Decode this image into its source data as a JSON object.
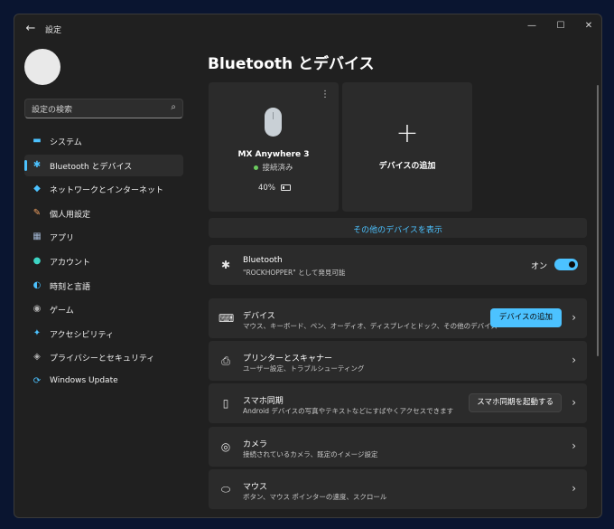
{
  "window": {
    "title": "設定",
    "back_icon": "←",
    "minimize_icon": "—",
    "maximize_icon": "☐",
    "close_icon": "✕"
  },
  "search": {
    "placeholder": "設定の検索",
    "icon": "⌕"
  },
  "sidebar": {
    "items": [
      {
        "label": "システム",
        "icon": "▬",
        "color": "#4cc2ff"
      },
      {
        "label": "Bluetooth とデバイス",
        "icon": "✱",
        "color": "#4cc2ff",
        "active": true
      },
      {
        "label": "ネットワークとインターネット",
        "icon": "◆",
        "color": "#4cc2ff"
      },
      {
        "label": "個人用設定",
        "icon": "✎",
        "color": "#f4a261"
      },
      {
        "label": "アプリ",
        "icon": "▦",
        "color": "#a0b4d0"
      },
      {
        "label": "アカウント",
        "icon": "●",
        "color": "#3dd5c4"
      },
      {
        "label": "時刻と言語",
        "icon": "◐",
        "color": "#4cc2ff"
      },
      {
        "label": "ゲーム",
        "icon": "◉",
        "color": "#b0b0b0"
      },
      {
        "label": "アクセシビリティ",
        "icon": "✦",
        "color": "#4cc2ff"
      },
      {
        "label": "プライバシーとセキュリティ",
        "icon": "◈",
        "color": "#b0b0b0"
      },
      {
        "label": "Windows Update",
        "icon": "⟳",
        "color": "#4cc2ff"
      }
    ]
  },
  "main": {
    "page_title": "Bluetooth とデバイス",
    "device": {
      "name": "MX Anywhere 3",
      "status": "接続済み",
      "battery": "40%",
      "battery_level": 0.4,
      "more_icon": "⋮"
    },
    "add_device": {
      "icon": "+",
      "label": "デバイスの追加"
    },
    "show_more": "その他のデバイスを表示",
    "bluetooth": {
      "icon": "✱",
      "title": "Bluetooth",
      "subtitle": "\"ROCKHOPPER\" として発見可能",
      "toggle_label": "オン",
      "toggle_on": true
    },
    "rows": [
      {
        "icon": "⌨",
        "title": "デバイス",
        "subtitle": "マウス、キーボード、ペン、オーディオ、ディスプレイとドック、その他のデバイス",
        "button": "デバイスの追加",
        "button_style": "accent"
      },
      {
        "icon": "⎙",
        "title": "プリンターとスキャナー",
        "subtitle": "ユーザー設定、トラブルシューティング"
      },
      {
        "icon": "▯",
        "title": "スマホ同期",
        "subtitle": "Android デバイスの写真やテキストなどにすばやくアクセスできます",
        "button": "スマホ同期を起動する",
        "button_style": "plain"
      },
      {
        "icon": "◎",
        "title": "カメラ",
        "subtitle": "接続されているカメラ、既定のイメージ設定"
      },
      {
        "icon": "⬭",
        "title": "マウス",
        "subtitle": "ボタン、マウス ポインターの速度、スクロール"
      }
    ],
    "chevron": "›"
  },
  "colors": {
    "accent": "#4cc2ff",
    "window_bg": "#202020",
    "card_bg": "#2b2b2b"
  }
}
